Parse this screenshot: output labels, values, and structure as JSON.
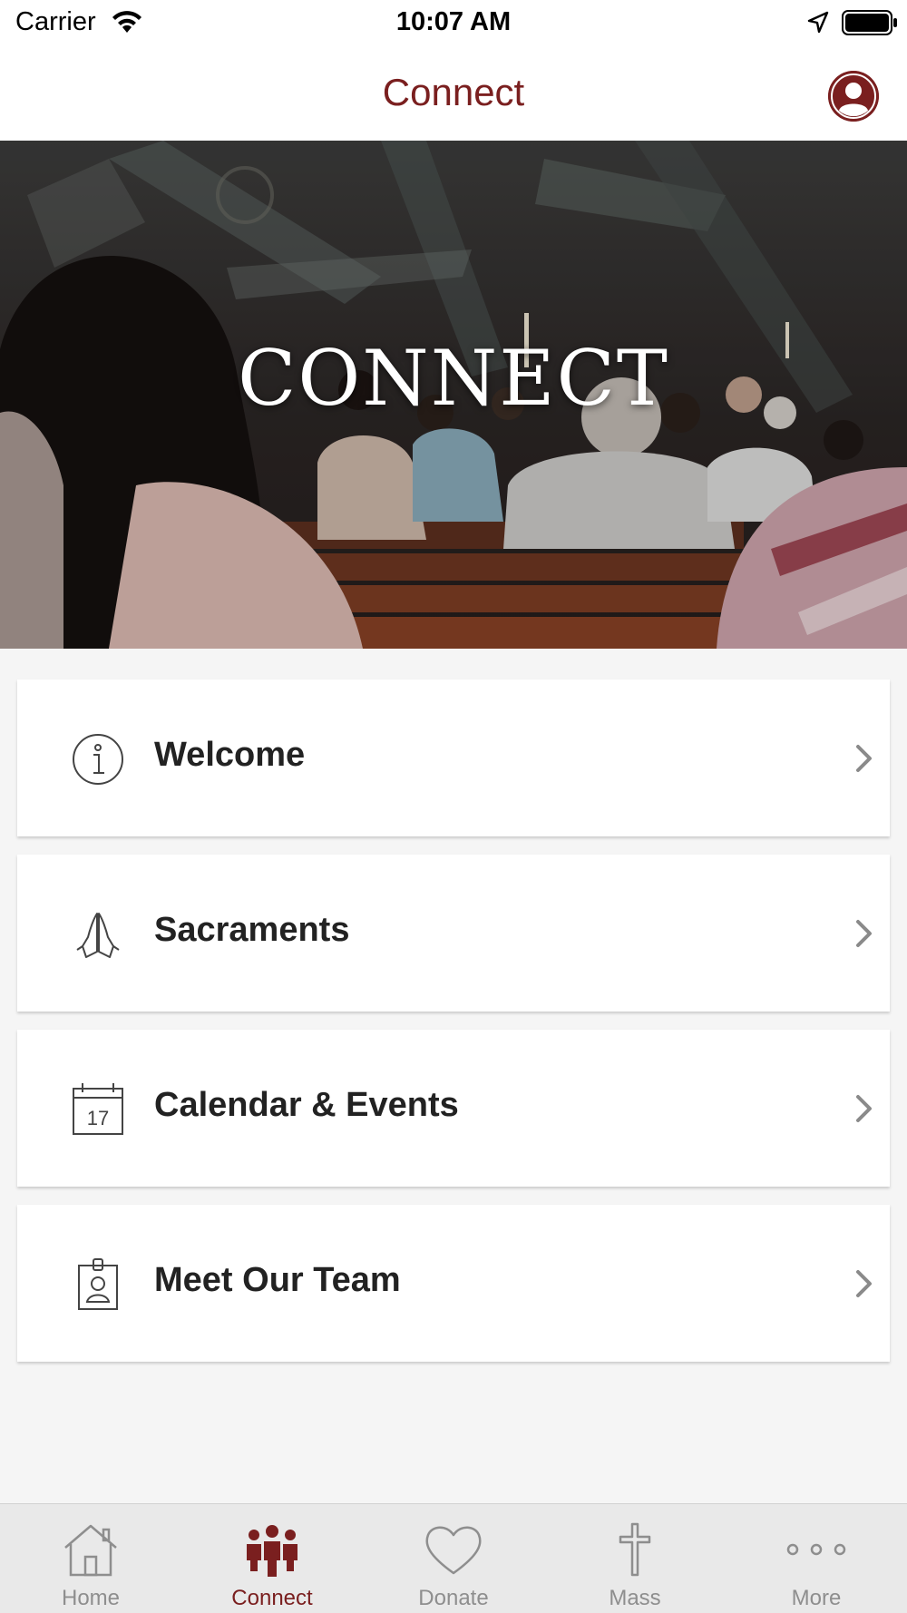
{
  "status_bar": {
    "carrier": "Carrier",
    "time": "10:07 AM",
    "icons": [
      "wifi-icon",
      "location-arrow-icon",
      "battery-icon"
    ]
  },
  "nav": {
    "title": "Connect",
    "profile_icon": "user-avatar-icon"
  },
  "hero": {
    "title": "CONNECT"
  },
  "menu": {
    "items": [
      {
        "label": "Welcome",
        "icon": "info-icon"
      },
      {
        "label": "Sacraments",
        "icon": "praying-hands-icon"
      },
      {
        "label": "Calendar & Events",
        "icon": "calendar-icon",
        "icon_text": "17"
      },
      {
        "label": "Meet Our Team",
        "icon": "id-badge-icon"
      }
    ]
  },
  "tabs": {
    "items": [
      {
        "label": "Home",
        "icon": "home-icon",
        "active": false
      },
      {
        "label": "Connect",
        "icon": "people-icon",
        "active": true
      },
      {
        "label": "Donate",
        "icon": "heart-icon",
        "active": false
      },
      {
        "label": "Mass",
        "icon": "cross-icon",
        "active": false
      },
      {
        "label": "More",
        "icon": "more-dots-icon",
        "active": false
      }
    ]
  },
  "colors": {
    "accent": "#7a1f1f",
    "tab_inactive": "#8e8e8e",
    "background": "#f5f5f5"
  }
}
